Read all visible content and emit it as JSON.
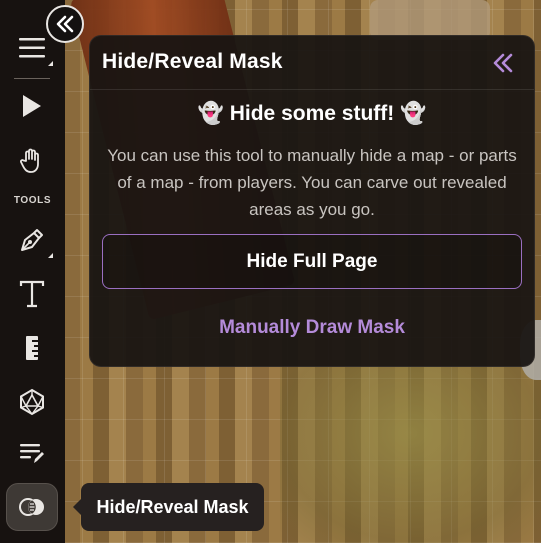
{
  "toolbar": {
    "section_label": "TOOLS",
    "items": [
      {
        "icon": "menu-icon"
      },
      {
        "icon": "pointer-icon"
      },
      {
        "icon": "hand-icon"
      },
      {
        "icon": "pen-icon"
      },
      {
        "icon": "text-icon"
      },
      {
        "icon": "ruler-icon"
      },
      {
        "icon": "dice-icon"
      },
      {
        "icon": "list-edit-icon"
      },
      {
        "icon": "mask-icon",
        "active": true
      }
    ],
    "collapse_icon": "double-chevron-left-icon"
  },
  "panel": {
    "title": "Hide/Reveal Mask",
    "heading": "👻 Hide some stuff! 👻",
    "description": "You can use this tool to manually hide a map - or parts of a map - from players. You can carve out revealed areas as you go.",
    "primary_button": "Hide Full Page",
    "secondary_button": "Manually Draw Mask",
    "close_icon": "double-chevron-left-icon",
    "accent_color": "#b48bd9"
  },
  "tooltip": {
    "text": "Hide/Reveal Mask"
  }
}
